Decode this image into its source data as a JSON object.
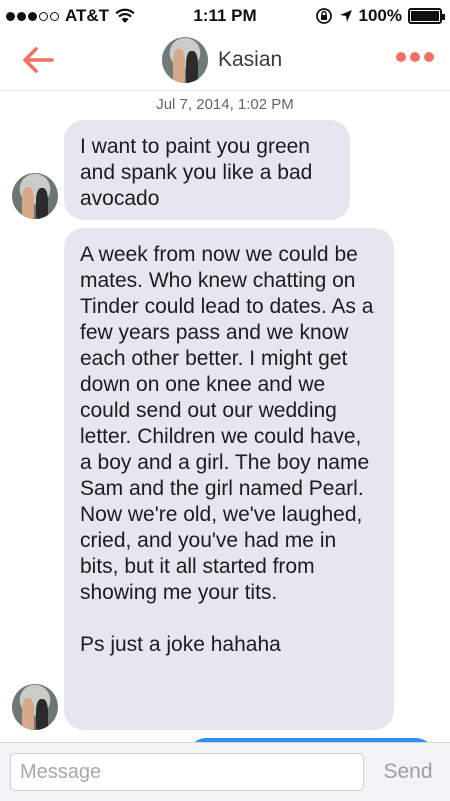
{
  "status_bar": {
    "carrier": "AT&T",
    "time": "1:11 PM",
    "battery": "100%",
    "battery_level": 1.0,
    "signal_bars_filled": 3,
    "signal_bars_total": 5
  },
  "header": {
    "contact_name": "Kasian",
    "back_icon": "back-arrow-icon",
    "more_icon": "more-dots-icon",
    "accent_color": "#f2705f"
  },
  "conversation": {
    "timestamp": "Jul 7, 2014, 1:02 PM",
    "messages": [
      {
        "sender": "contact",
        "text": "I want to paint you green and spank you like a bad avocado"
      },
      {
        "sender": "contact",
        "text": "A week from now we could be mates. Who knew chatting on Tinder could lead to dates. As a few years pass and we know each other better. I might get down on one knee and we could send out our wedding letter. Children we could have, a boy and a girl. The boy name Sam and the girl named Pearl. Now we're old, we've laughed, cried, and you've had me in bits, but it all started from showing me your tits.",
        "postscript": "Ps just a joke hahaha"
      }
    ],
    "bubble_color": "#e7e6f0",
    "outgoing_bubble_color": "#2e8ff0"
  },
  "input_bar": {
    "placeholder": "Message",
    "value": "",
    "send_label": "Send"
  }
}
